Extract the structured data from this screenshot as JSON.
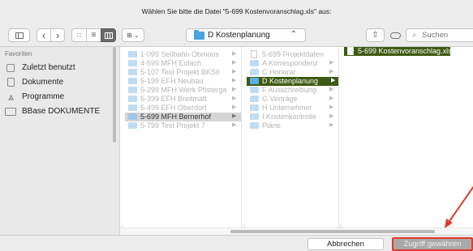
{
  "dialog": {
    "title": "Wählen Sie bitte die Datei \"5-699 Kostenvoranschlag.xls\" aus:"
  },
  "toolbar": {
    "back_icon": "‹",
    "forward_icon": "›",
    "path_label": "D Kostenplanung",
    "path_chevron": "⌃",
    "search_placeholder": "Suchen",
    "share_icon": "share-icon",
    "tag_icon": "tag-icon"
  },
  "sidebar": {
    "header": "Favoriten",
    "items": [
      {
        "label": "Zuletzt benutzt",
        "icon": "clock-icon"
      },
      {
        "label": "Dokumente",
        "icon": "document-icon"
      },
      {
        "label": "Programme",
        "icon": "apps-icon"
      },
      {
        "label": "BBase DOKUMENTE",
        "icon": "folder-icon"
      }
    ]
  },
  "columns": [
    {
      "items": [
        {
          "label": "1-099 Seilbahn Obmoos",
          "type": "folder",
          "selected": ""
        },
        {
          "label": "4-599 MFH Eulach",
          "type": "folder",
          "selected": ""
        },
        {
          "label": "5-107 Test Projekt BKSII",
          "type": "folder",
          "selected": ""
        },
        {
          "label": "5-199 EFH Neubau",
          "type": "folder",
          "selected": ""
        },
        {
          "label": "5-299 MFH Werk Pfisterga",
          "type": "folder",
          "selected": ""
        },
        {
          "label": "5-399 EFH Breitmatt",
          "type": "folder",
          "selected": ""
        },
        {
          "label": "5-499 EFH Oberdorf",
          "type": "folder",
          "selected": ""
        },
        {
          "label": "5-699 MFH Bernerhof",
          "type": "folder",
          "selected": "grey"
        },
        {
          "label": "5-799 Test Projekt 7",
          "type": "folder",
          "selected": ""
        }
      ]
    },
    {
      "items": [
        {
          "label": "5-699 Projektdaten",
          "type": "doc",
          "selected": ""
        },
        {
          "label": "A Korrespondenz",
          "type": "folder",
          "selected": ""
        },
        {
          "label": "C Honorar",
          "type": "folder",
          "selected": ""
        },
        {
          "label": "D Kostenplanung",
          "type": "folder",
          "selected": "green"
        },
        {
          "label": "F Ausschreibung",
          "type": "folder",
          "selected": ""
        },
        {
          "label": "G Verträge",
          "type": "folder",
          "selected": ""
        },
        {
          "label": "H Unternehmer",
          "type": "folder",
          "selected": ""
        },
        {
          "label": "I Kostenkontrolle",
          "type": "folder",
          "selected": ""
        },
        {
          "label": "Pläne",
          "type": "folder",
          "selected": ""
        }
      ]
    },
    {
      "items": [
        {
          "label": "5-699 Kostenvoranschlag.xls",
          "type": "doc",
          "selected": "green"
        }
      ]
    }
  ],
  "buttons": {
    "cancel": "Abbrechen",
    "grant": "Zugriff gewähren"
  },
  "colors": {
    "selection_green": "#3d5a12",
    "selection_grey": "#d5d5d5",
    "folder_blue": "#4aa3e0",
    "annotation_red": "#e03a2a"
  }
}
